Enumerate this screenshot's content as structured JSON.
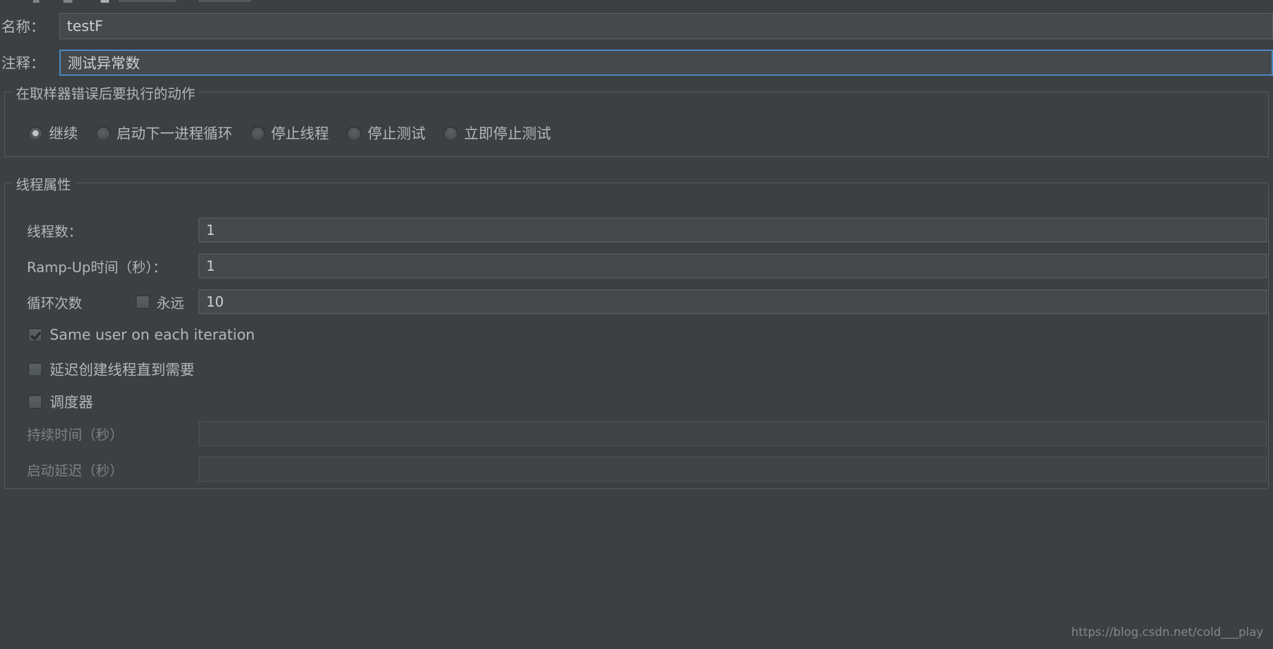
{
  "form": {
    "name_label": "名称：",
    "name_value": "testF",
    "comment_label": "注释：",
    "comment_value": "测试异常数"
  },
  "error_action_group": {
    "title": "在取样器错误后要执行的动作",
    "options": [
      {
        "label": "继续",
        "selected": true
      },
      {
        "label": "启动下一进程循环",
        "selected": false
      },
      {
        "label": "停止线程",
        "selected": false
      },
      {
        "label": "停止测试",
        "selected": false
      },
      {
        "label": "立即停止测试",
        "selected": false
      }
    ]
  },
  "thread_group": {
    "title": "线程属性",
    "threads_label": "线程数：",
    "threads_value": "1",
    "rampup_label": "Ramp-Up时间（秒）：",
    "rampup_value": "1",
    "loops_label": "循环次数",
    "forever_label": "永远",
    "forever_checked": false,
    "loops_value": "10",
    "same_user_label": "Same user on each iteration",
    "same_user_checked": true,
    "delayed_create_label": "延迟创建线程直到需要",
    "delayed_create_checked": false,
    "scheduler_label": "调度器",
    "scheduler_checked": false,
    "duration_label": "持续时间（秒）",
    "duration_value": "",
    "duration_disabled": true,
    "startup_delay_label": "启动延迟（秒）",
    "startup_delay_value": "",
    "startup_delay_disabled": true
  },
  "watermark": "https://blog.csdn.net/cold___play",
  "colors": {
    "background": "#3c4043",
    "field_background": "#45494c",
    "border": "#5c6164",
    "focus_border": "#4a88c7",
    "text": "#b6b6b6",
    "disabled_text": "#7d8184"
  }
}
